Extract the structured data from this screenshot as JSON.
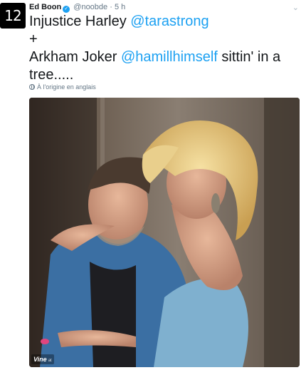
{
  "author": {
    "avatar_text": "12",
    "name": "Ed Boon",
    "verified_icon": "verified-badge-icon",
    "handle": "@noobde",
    "separator": "·",
    "time": "5 h"
  },
  "tweet": {
    "line1_text": "Injustice Harley ",
    "line1_mention": "@tarastrong",
    "line2_text": "+",
    "line3_text": "Arkham Joker ",
    "line3_mention": "@hamillhimself",
    "line3_rest": " sittin' in a",
    "line4_text": "tree....."
  },
  "translation": {
    "icon": "globe-icon",
    "label": "À l'origine en anglais"
  },
  "media": {
    "type": "vine-video",
    "vine_label": "Vine",
    "vine_sub": "at"
  },
  "colors": {
    "link": "#1da1f2",
    "muted": "#657786"
  }
}
